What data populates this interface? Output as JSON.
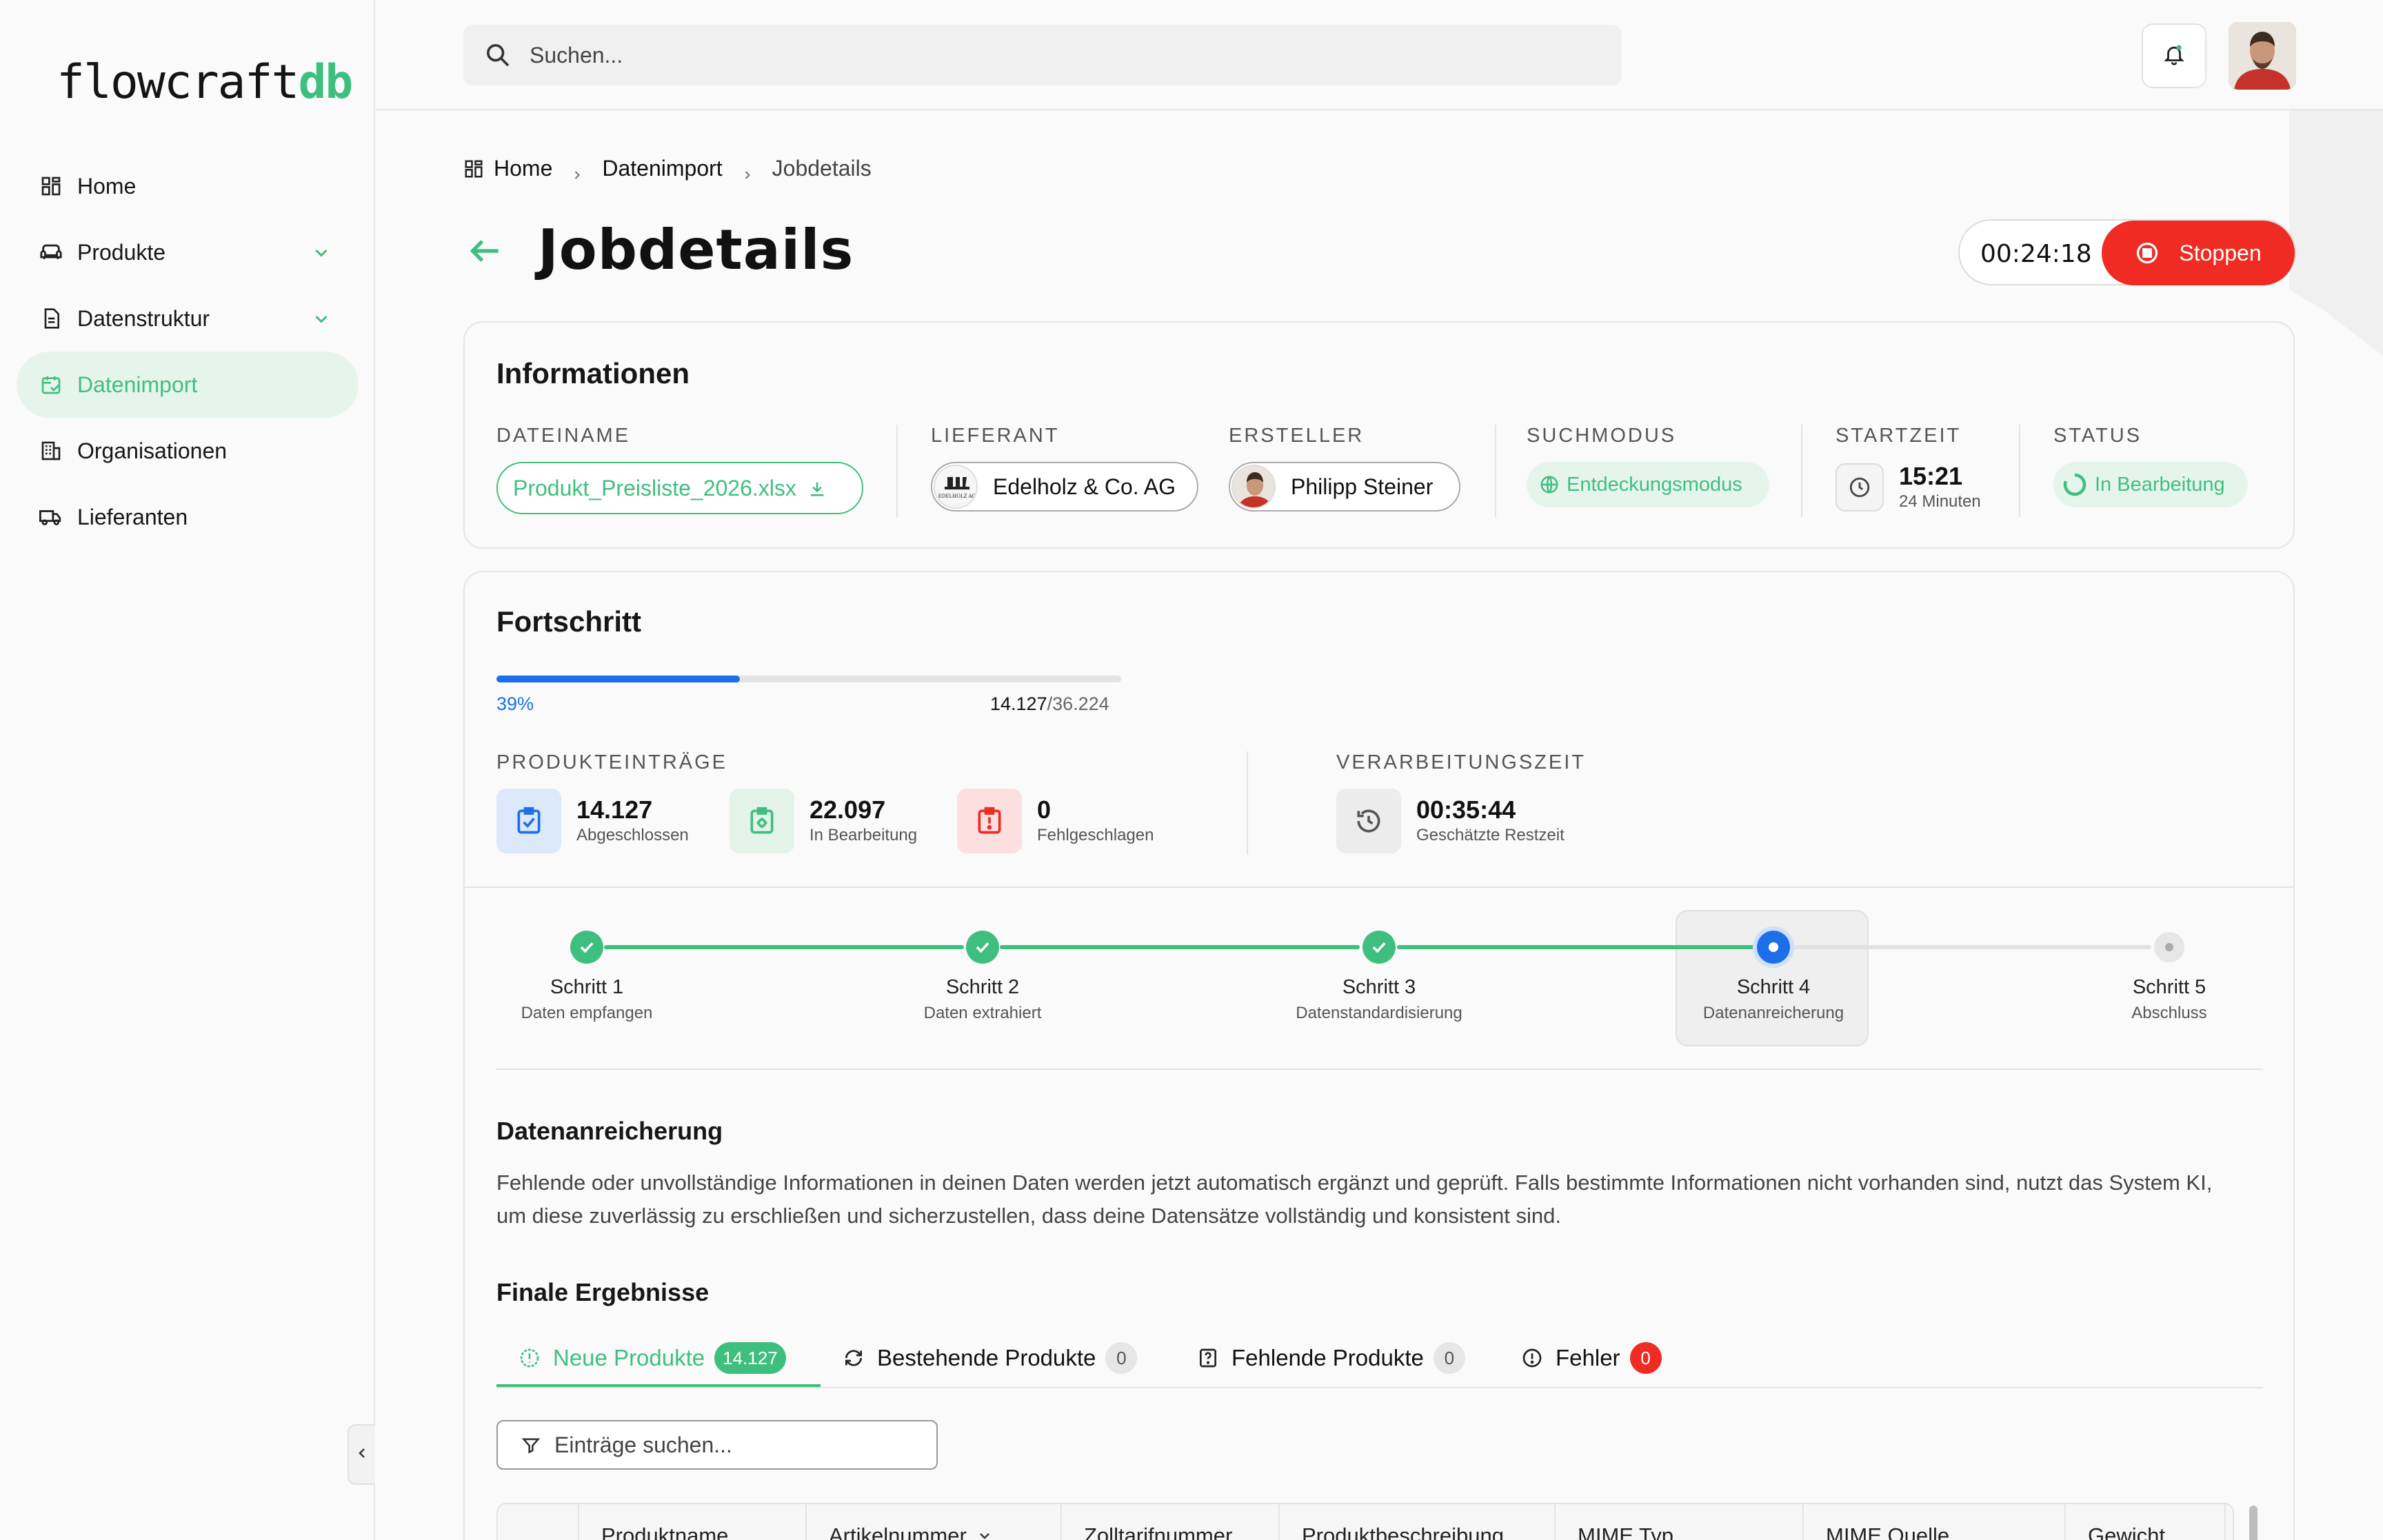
{
  "app": {
    "logo_main": "flowcraft",
    "logo_suffix": "db"
  },
  "sidebar": {
    "items": [
      {
        "label": "Home",
        "icon": "grid-icon"
      },
      {
        "label": "Produkte",
        "icon": "sofa-icon",
        "has_chevron": true
      },
      {
        "label": "Datenstruktur",
        "icon": "document-icon",
        "has_chevron": true
      },
      {
        "label": "Datenimport",
        "icon": "calendar-import-icon",
        "active": true
      },
      {
        "label": "Organisationen",
        "icon": "building-icon"
      },
      {
        "label": "Lieferanten",
        "icon": "truck-icon"
      }
    ]
  },
  "search": {
    "placeholder": "Suchen..."
  },
  "breadcrumb": {
    "items": [
      "Home",
      "Datenimport",
      "Jobdetails"
    ]
  },
  "page": {
    "title": "Jobdetails",
    "timer": "00:24:18",
    "stop_label": "Stoppen"
  },
  "info": {
    "title": "Informationen",
    "labels": {
      "file": "DATEINAME",
      "supplier": "LIEFERANT",
      "creator": "ERSTELLER",
      "mode": "SUCHMODUS",
      "start": "STARTZEIT",
      "status": "STATUS"
    },
    "file_name": "Produkt_Preisliste_2026.xlsx",
    "supplier_name": "Edelholz & Co. AG",
    "supplier_logo_text": "EDELHOLZ AG",
    "creator_name": "Philipp Steiner",
    "mode_value": "Entdeckungsmodus",
    "start_time": "15:21",
    "start_ago": "24 Minuten",
    "status_value": "In Bearbeitung"
  },
  "progress": {
    "title": "Fortschritt",
    "percent_label": "39%",
    "percent": 0.39,
    "done": "14.127",
    "total": "/36.224",
    "entries_label": "PRODUKTEINTRÄGE",
    "stats": [
      {
        "value": "14.127",
        "label": "Abgeschlossen"
      },
      {
        "value": "22.097",
        "label": "In Bearbeitung"
      },
      {
        "value": "0",
        "label": "Fehlgeschlagen"
      }
    ],
    "processing_label": "VERARBEITUNGSZEIT",
    "remaining_value": "00:35:44",
    "remaining_label": "Geschätzte Restzeit"
  },
  "steps": [
    {
      "title": "Schritt 1",
      "sub": "Daten empfangen",
      "state": "done"
    },
    {
      "title": "Schritt 2",
      "sub": "Daten extrahiert",
      "state": "done"
    },
    {
      "title": "Schritt 3",
      "sub": "Datenstandardisierung",
      "state": "done"
    },
    {
      "title": "Schritt 4",
      "sub": "Datenanreicherung",
      "state": "current"
    },
    {
      "title": "Schritt 5",
      "sub": "Abschluss",
      "state": "pending"
    }
  ],
  "enrichment": {
    "title": "Datenanreicherung",
    "text": "Fehlende oder unvollständige Informationen in deinen Daten werden jetzt automatisch ergänzt und geprüft. Falls bestimmte Informationen nicht vorhanden sind, nutzt das System KI, um diese zuverlässig zu erschließen und sicherzustellen, dass deine Datensätze vollständig und konsistent sind."
  },
  "results": {
    "title": "Finale Ergebnisse",
    "tabs": [
      {
        "label": "Neue Produkte",
        "count": "14.127",
        "icon": "info-circle-icon",
        "active": true
      },
      {
        "label": "Bestehende Produkte",
        "count": "0",
        "icon": "refresh-icon"
      },
      {
        "label": "Fehlende Produkte",
        "count": "0",
        "icon": "question-box-icon"
      },
      {
        "label": "Fehler",
        "count": "0",
        "icon": "alert-circle-icon"
      }
    ],
    "filter_placeholder": "Einträge suchen...",
    "columns": [
      "Produktname",
      "Artikelnummer",
      "Zolltarifnummer",
      "Produktbeschreibung",
      "MIME Typ",
      "MIME Quelle",
      "Gewicht"
    ]
  },
  "colors": {
    "accent": "#3fbf7f",
    "danger": "#ef2b24",
    "progress": "#1c6fe8"
  }
}
